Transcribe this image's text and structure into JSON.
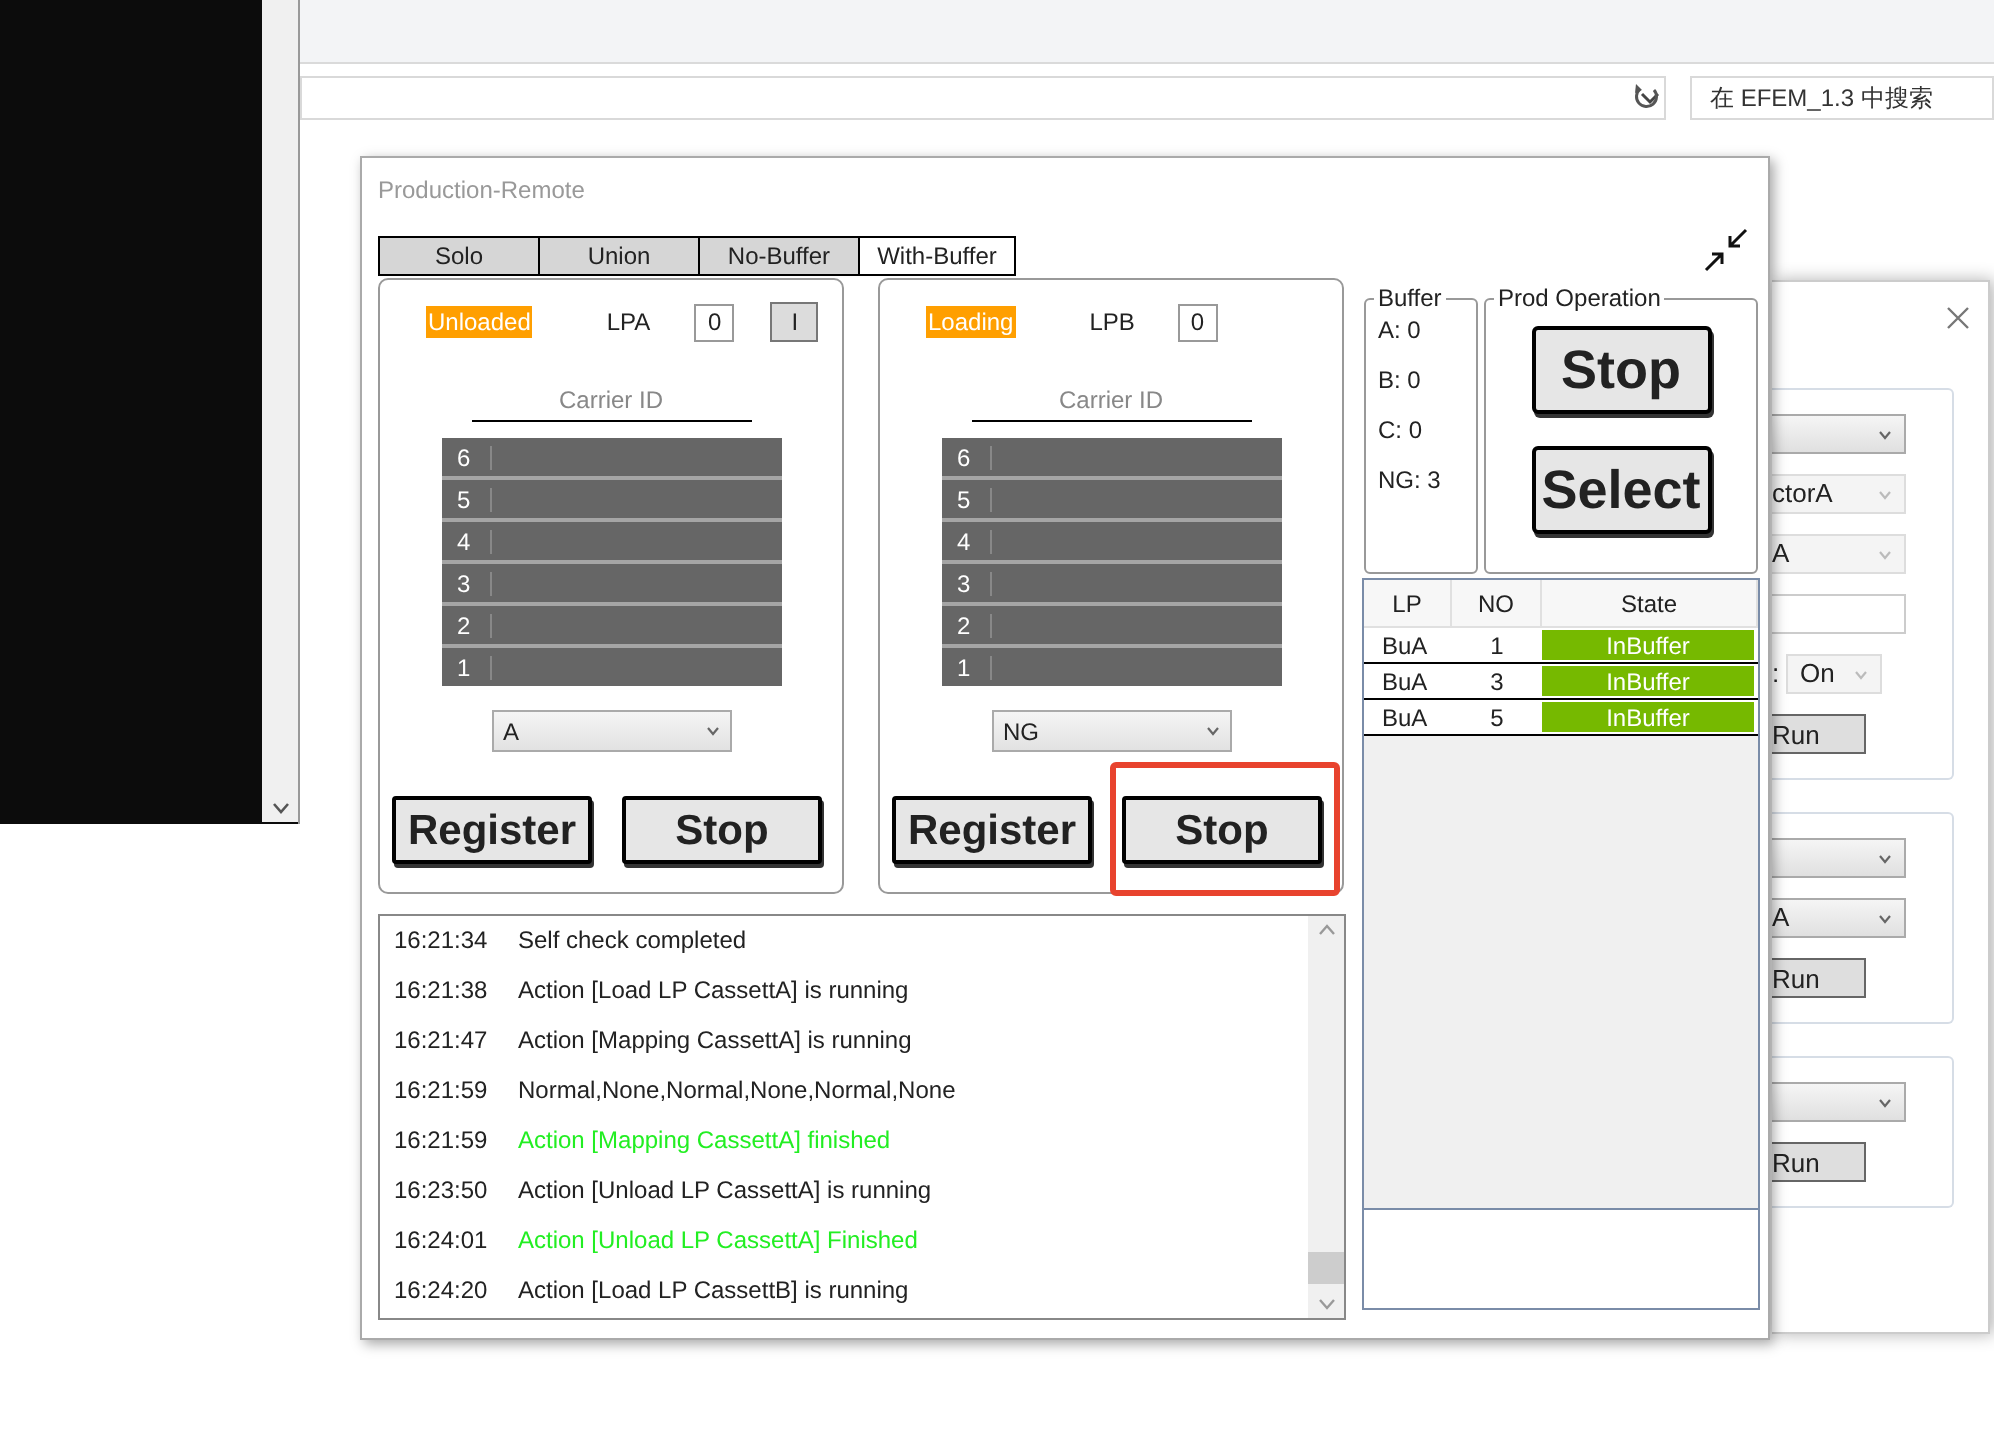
{
  "explorer": {
    "search": {
      "placeholder": "在 EFEM_1.3 中搜索"
    }
  },
  "window": {
    "title": "Production-Remote"
  },
  "tabs": [
    {
      "label": "Solo",
      "selected": false
    },
    {
      "label": "Union",
      "selected": false
    },
    {
      "label": "No-Buffer",
      "selected": false
    },
    {
      "label": "With-Buffer",
      "selected": true
    }
  ],
  "load_ports": [
    {
      "status": "Unloaded",
      "name": "LPA",
      "count": "0",
      "indicator": "I",
      "carrier_id_label": "Carrier ID",
      "slots": [
        "6",
        "5",
        "4",
        "3",
        "2",
        "1"
      ],
      "cassette": "A",
      "buttons": [
        {
          "label": "Register",
          "highlighted": false
        },
        {
          "label": "Stop",
          "highlighted": false
        }
      ]
    },
    {
      "status": "Loading",
      "name": "LPB",
      "count": "0",
      "carrier_id_label": "Carrier ID",
      "slots": [
        "6",
        "5",
        "4",
        "3",
        "2",
        "1"
      ],
      "cassette": "NG",
      "buttons": [
        {
          "label": "Register",
          "highlighted": false
        },
        {
          "label": "Stop",
          "highlighted": true
        }
      ]
    }
  ],
  "buffer": {
    "title": "Buffer",
    "counts": [
      "A: 0",
      "B: 0",
      "C: 0",
      "NG: 3"
    ]
  },
  "prod_operation": {
    "title": "Prod Operation",
    "buttons": [
      "Stop",
      "Select"
    ]
  },
  "buffer_table": {
    "columns": [
      "LP",
      "NO",
      "State"
    ],
    "rows": [
      {
        "lp": "BuA",
        "no": "1",
        "state": "InBuffer"
      },
      {
        "lp": "BuA",
        "no": "3",
        "state": "InBuffer"
      },
      {
        "lp": "BuA",
        "no": "5",
        "state": "InBuffer"
      }
    ]
  },
  "log": [
    {
      "time": "16:21:34",
      "message": "Self check completed",
      "kind": "info"
    },
    {
      "time": "16:21:38",
      "message": "Action [Load LP CassettA] is running",
      "kind": "info"
    },
    {
      "time": "16:21:47",
      "message": "Action [Mapping CassettA] is running",
      "kind": "info"
    },
    {
      "time": "16:21:59",
      "message": "Normal,None,Normal,None,Normal,None",
      "kind": "info"
    },
    {
      "time": "16:21:59",
      "message": "Action [Mapping CassettA] finished",
      "kind": "success"
    },
    {
      "time": "16:23:50",
      "message": "Action [Unload LP CassettA] is running",
      "kind": "info"
    },
    {
      "time": "16:24:01",
      "message": "Action [Unload LP CassettA] Finished",
      "kind": "success"
    },
    {
      "time": "16:24:20",
      "message": "Action [Load LP CassettB] is running",
      "kind": "info"
    }
  ],
  "back_dialog": {
    "groups": [
      {
        "fields": [
          {
            "kind": "combo",
            "disabled": false
          },
          {
            "kind": "combo",
            "value": "ctorA",
            "disabled": true
          },
          {
            "kind": "combo",
            "value": "A",
            "disabled": true
          },
          {
            "kind": "input"
          },
          {
            "kind": "combo",
            "label": ":",
            "value": "On",
            "disabled": true
          },
          {
            "kind": "button",
            "label": "Run"
          }
        ]
      },
      {
        "fields": [
          {
            "kind": "combo",
            "disabled": false
          },
          {
            "kind": "combo",
            "value": "A",
            "disabled": false
          },
          {
            "kind": "button",
            "label": "Run"
          }
        ]
      },
      {
        "fields": [
          {
            "kind": "combo",
            "disabled": false
          },
          {
            "kind": "button",
            "label": "Run"
          }
        ]
      }
    ]
  }
}
